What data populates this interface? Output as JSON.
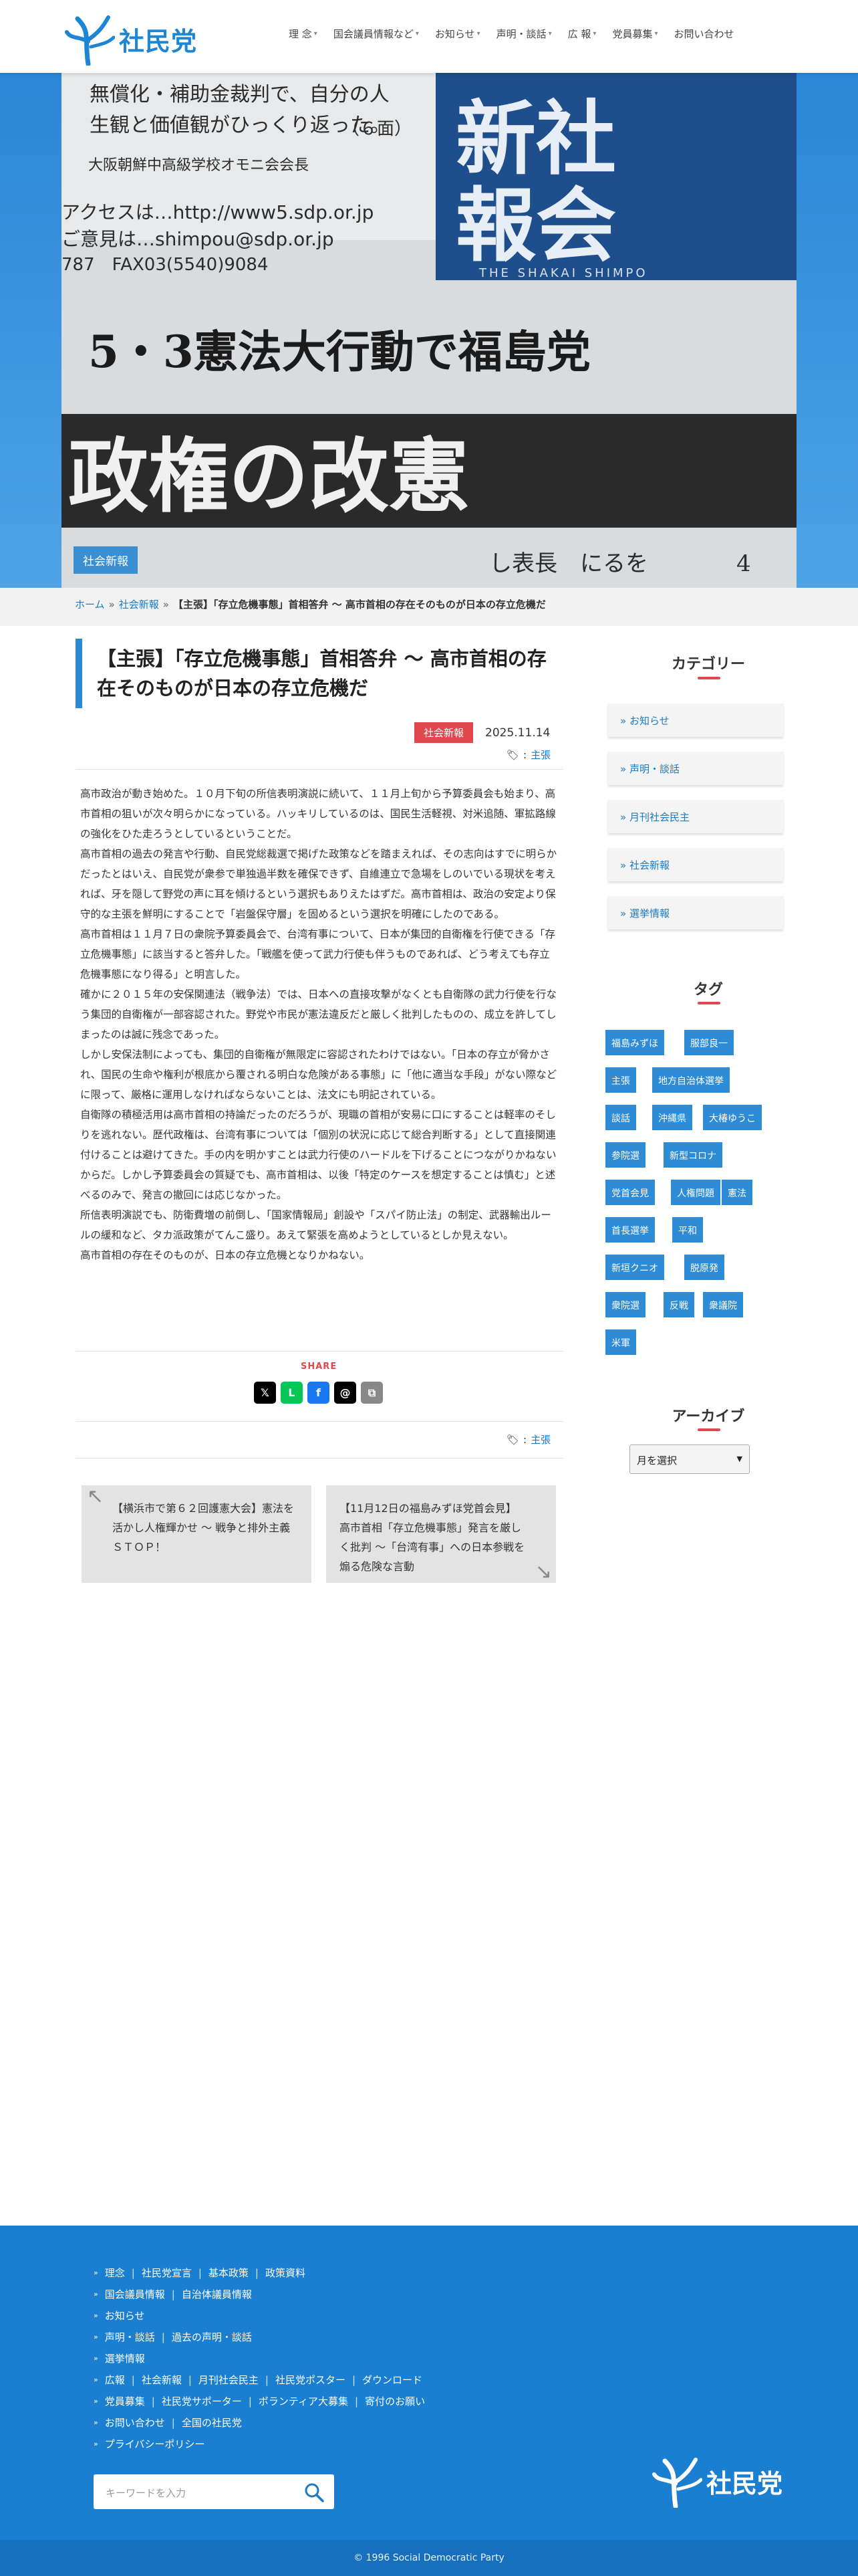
{
  "header": {
    "logo_text": "社民党",
    "nav": [
      {
        "label": "理 念",
        "caret": true
      },
      {
        "label": "国会議員情報など",
        "caret": true
      },
      {
        "label": "お知らせ",
        "caret": true
      },
      {
        "label": "声明・談話",
        "caret": true
      },
      {
        "label": "広 報",
        "caret": true
      },
      {
        "label": "党員募集",
        "caret": true
      },
      {
        "label": "お問い合わせ",
        "caret": false
      }
    ]
  },
  "hero": {
    "badge": "社会新報",
    "photo_lines": [
      "無償化・補助金裁判で、自分の人",
      "生観と価値観がひっくり返った。",
      "（６面）",
      "大阪朝鮮中高級学校オモニ会会長",
      "アクセスは…http://www5.sdp.or.jp",
      "ご意見は…shimpou@sdp.or.jp",
      "787　FAX03(5540)9084",
      "新社",
      "報会",
      "THE SHAKAI SHIMPO",
      "5・3憲法大行動で福島党",
      "政権の改憲",
      "し表長　にるを",
      "4"
    ]
  },
  "breadcrumb": {
    "home": "ホーム",
    "sep": "»",
    "category": "社会新報",
    "current": "【主張】「存立危機事態」首相答弁 〜 高市首相の存在そのものが日本の存立危機だ"
  },
  "article": {
    "title": "【主張】「存立危機事態」首相答弁 〜 高市首相の存在そのものが日本の存立危機だ",
    "category": "社会新報",
    "date": "2025.11.14",
    "tag_prefix": ":",
    "tag": "主張",
    "paragraphs": [
      "高市政治が動き始めた。１０月下旬の所信表明演説に続いて、１１月上旬から予算委員会も始まり、高市首相の狙いが次々明らかになっている。ハッキリしているのは、国民生活軽視、対米追随、軍拡路線の強化をひた走ろうとしているということだ。",
      "高市首相の過去の発言や行動、自民党総裁選で掲げた政策などを踏まえれば、その志向はすでに明らかだったとはいえ、自民党が衆参で単独過半数を確保できず、自維連立で急場をしのいでいる現状を考えれば、牙を隠して野党の声に耳を傾けるという選択もありえたはずだ。高市首相は、政治の安定より保守的な主張を鮮明にすることで「岩盤保守層」を固めるという選択を明確にしたのである。",
      "高市首相は１１月７日の衆院予算委員会で、台湾有事について、日本が集団的自衛権を行使できる「存立危機事態」に該当すると答弁した。「戦艦を使って武力行使も伴うものであれば、どう考えても存立危機事態になり得る」と明言した。",
      "確かに２０１５年の安保関連法（戦争法）では、日本への直接攻撃がなくとも自衛隊の武力行使を行なう集団的自衛権が一部容認された。野党や市民が憲法違反だと厳しく批判したものの、成立を許してしまったのは誠に残念であった。",
      "しかし安保法制によっても、集団的自衛権が無限定に容認されたわけではない。「日本の存立が脅かされ、国民の生命や権利が根底から覆される明白な危険がある事態」に「他に適当な手段」がない際などに限って、厳格に運用しなければならないことは、法文にも明記されている。",
      "自衛隊の積極活用は高市首相の持論だったのだろうが、現職の首相が安易に口にすることは軽率のそしりを逃れない。歴代政権は、台湾有事については「個別の状況に応じて総合判断する」として直接関連付けることは避けてきた。手の内を明かすことは武力行使のハードルを下げることにつながりかねないからだ。しかし予算委員会の質疑でも、高市首相は、以後「特定のケースを想定することは慎む」と述べるのみで、発言の撤回には応じなかった。",
      "所信表明演説でも、防衛費増の前倒し、「国家情報局」創設や「スパイ防止法」の制定、武器輸出ルールの緩和など、タカ派政策がてんこ盛り。あえて緊張を高めようとしているとしか見えない。",
      "高市首相の存在そのものが、日本の存立危機となりかねない。"
    ],
    "share_label": "SHARE",
    "share": [
      {
        "name": "x",
        "glyph": "𝕏",
        "color": "#000000"
      },
      {
        "name": "line",
        "glyph": "L",
        "color": "#06c755"
      },
      {
        "name": "facebook",
        "glyph": "f",
        "color": "#1877f2"
      },
      {
        "name": "threads",
        "glyph": "@",
        "color": "#000000"
      },
      {
        "name": "copy",
        "glyph": "⧉",
        "color": "#888888"
      }
    ],
    "prev": "【横浜市で第６２回護憲大会】憲法を活かし人権輝かせ 〜 戦争と排外主義ＳＴＯＰ！",
    "next": "【11月12日の福島みずほ党首会見】高市首相「存立危機事態」発言を厳しく批判 〜「台湾有事」への日本参戦を煽る危険な言動"
  },
  "sidebar": {
    "category_heading": "カテゴリー",
    "categories": [
      "お知らせ",
      "声明・談話",
      "月刊社会民主",
      "社会新報",
      "選挙情報"
    ],
    "tag_heading": "タグ",
    "tags": [
      "福島みずほ",
      "服部良一",
      "主張",
      "地方自治体選挙",
      "談話",
      "沖縄県",
      "大椿ゆうこ",
      "参院選",
      "新型コロナ",
      "党首会見",
      "人権問題",
      "憲法",
      "首長選挙",
      "平和",
      "新垣クニオ",
      "脱原発",
      "衆院選",
      "反戦",
      "衆議院",
      "米軍"
    ],
    "archive_heading": "アーカイブ",
    "archive_select": "月を選択"
  },
  "footer": {
    "lines": [
      [
        "理念",
        "社民党宣言",
        "基本政策",
        "政策資料"
      ],
      [
        "国会議員情報",
        "自治体議員情報"
      ],
      [
        "お知らせ"
      ],
      [
        "声明・談話",
        "過去の声明・談話"
      ],
      [
        "選挙情報"
      ],
      [
        "広報",
        "社会新報",
        "月刊社会民主",
        "社民党ポスター",
        "ダウンロード"
      ],
      [
        "党員募集",
        "社民党サポーター",
        "ボランティア大募集",
        "寄付のお願い"
      ],
      [
        "お問い合わせ",
        "全国の社民党"
      ],
      [
        "プライバシーポリシー"
      ]
    ],
    "search_placeholder": "キーワードを入力",
    "logo_text": "社民党",
    "copyright": "© 1996 Social Democratic Party"
  },
  "colors": {
    "brand_blue": "#1a7fd1",
    "accent_red": "#e0484e",
    "tag_blue": "#2e8bd6"
  }
}
